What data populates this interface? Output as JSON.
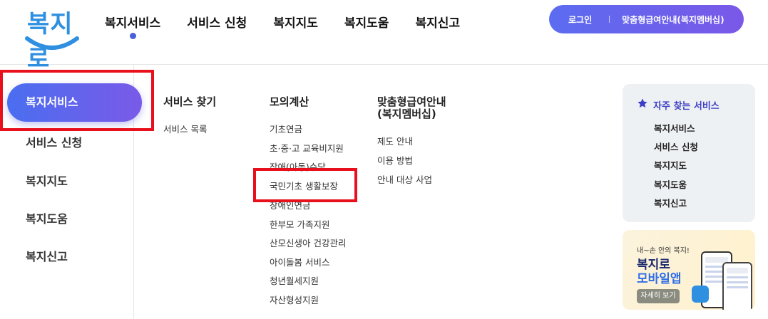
{
  "logo": {
    "text": "복지로"
  },
  "gnb": [
    "복지서비스",
    "서비스 신청",
    "복지지도",
    "복지도움",
    "복지신고"
  ],
  "auth": {
    "login": "로그인",
    "membership": "맞춤형급여안내(복지멤버십)"
  },
  "sidebar": {
    "active": "복지서비스",
    "items": [
      "서비스 신청",
      "복지지도",
      "복지도움",
      "복지신고"
    ]
  },
  "menu": {
    "col1": {
      "title": "서비스 찾기",
      "links": [
        "서비스 목록"
      ]
    },
    "col2": {
      "title": "모의계산",
      "links": [
        "기초연금",
        "초·중·고 교육비지원",
        "장애(아동)수당",
        "국민기초 생활보장",
        "장애인연금",
        "한부모 가족지원",
        "산모신생아 건강관리",
        "아이돌봄 서비스",
        "청년월세지원",
        "자산형성지원"
      ]
    },
    "col3": {
      "title_line1": "맞춤형급여안내",
      "title_line2": "(복지멤버십)",
      "links": [
        "제도 안내",
        "이용 방법",
        "안내 대상 사업"
      ]
    }
  },
  "favorites": {
    "title": "자주 찾는 서비스",
    "links": [
      "복지서비스",
      "서비스 신청",
      "복지지도",
      "복지도움",
      "복지신고"
    ]
  },
  "app_banner": {
    "small": "내~손 안의 복지!",
    "line1": "복지로",
    "line2": "모바일앱",
    "button": "자세히 보기"
  },
  "colors": {
    "accent": "#5b6cf0",
    "highlight_box": "#e8101c",
    "favorites_title": "#3d3fc4"
  }
}
